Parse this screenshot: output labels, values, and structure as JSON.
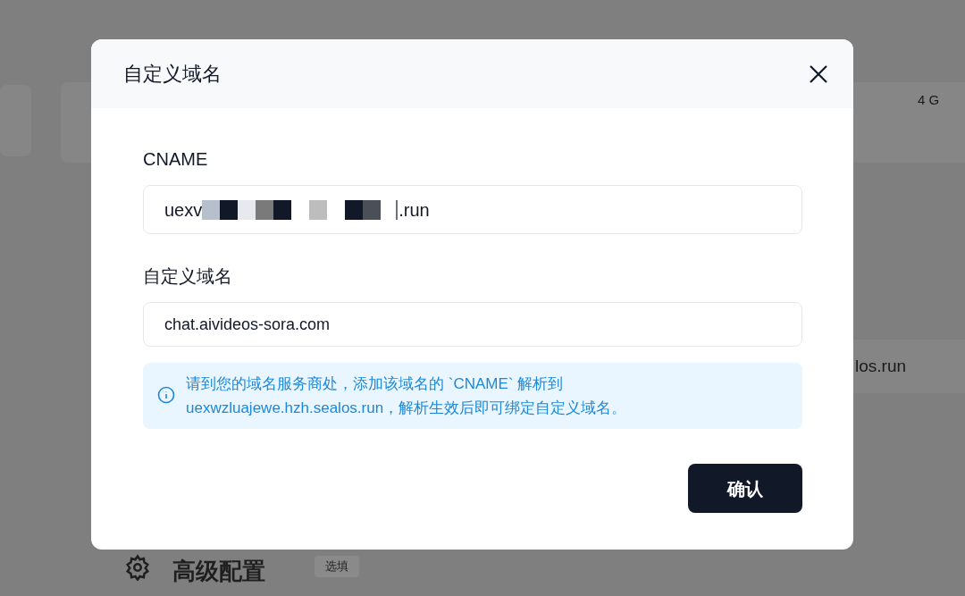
{
  "background": {
    "memory": "4 G",
    "domain_fragment": "los.run",
    "section_title": "高级配置",
    "section_badge": "选填"
  },
  "dialog": {
    "title": "自定义域名",
    "fields": [
      {
        "label": "CNAME",
        "kind": "redacted",
        "value_start": "uexv",
        "value_end": ".run"
      },
      {
        "label": "自定义域名",
        "kind": "text",
        "value": "chat.aivideos-sora.com"
      }
    ],
    "notice": "请到您的域名服务商处，添加该域名的 `CNAME` 解析到 uexwzluajewe.hzh.sealos.run，解析生效后即可绑定自定义域名。",
    "confirm_button": "确认"
  }
}
